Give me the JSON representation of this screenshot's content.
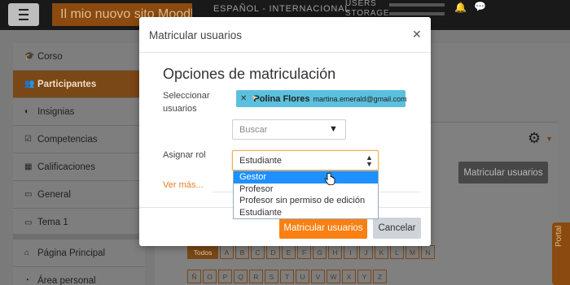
{
  "background": {
    "site_name": "Il mio nuovo sito Moodle",
    "language": "ESPAÑOL - INTERNACIONAL",
    "users_label": "USERS",
    "storage_label": "STORAGE",
    "sidebar": [
      {
        "label": "Corso",
        "icon": "graduation-cap-icon",
        "glyph": "🎓"
      },
      {
        "label": "Participantes",
        "icon": "users-icon",
        "glyph": "👥",
        "active": true
      },
      {
        "label": "Insignias",
        "icon": "shield-icon",
        "glyph": "◐"
      },
      {
        "label": "Competencias",
        "icon": "check-square-icon",
        "glyph": "☑"
      },
      {
        "label": "Calificaciones",
        "icon": "table-icon",
        "glyph": "▦"
      },
      {
        "label": "General",
        "icon": "folder-icon",
        "glyph": "▭"
      },
      {
        "label": "Tema 1",
        "icon": "folder-icon",
        "glyph": "▭"
      },
      {
        "label": "Página Principal",
        "icon": "home-icon",
        "glyph": "⌂"
      },
      {
        "label": "Área personal",
        "icon": "dashboard-icon",
        "glyph": "◔"
      }
    ],
    "enrol_button": "Matricular usuarios",
    "letters_row1": [
      "Todos",
      "A",
      "B",
      "C",
      "D",
      "E",
      "F",
      "G",
      "H",
      "I",
      "J",
      "K",
      "L",
      "M",
      "N"
    ],
    "letters_row2": [
      "Ñ",
      "O",
      "P",
      "Q",
      "R",
      "S",
      "T",
      "U",
      "V",
      "W",
      "X",
      "Y",
      "Z"
    ],
    "portal_tab": "Portal"
  },
  "modal": {
    "title": "Matricular usuarios",
    "section_title": "Opciones de matriculación",
    "select_users_label": "Seleccionar usuarios",
    "selected_user": {
      "name": "Polina Flores",
      "email": "martina.emerald@gmail.com"
    },
    "search_placeholder": "Buscar",
    "assign_role_label": "Asignar rol",
    "role_value": "Estudiante",
    "role_options": [
      "Gestor",
      "Profesor",
      "Profesor sin permiso de edición",
      "Estudiante"
    ],
    "selected_option": "Gestor",
    "more_link": "Ver más...",
    "enrol_button": "Matricular usuarios",
    "cancel_button": "Cancelar"
  },
  "colors": {
    "accent": "#f98012",
    "chip": "#5bc0de",
    "dropdown_highlight": "#1e90ff"
  }
}
